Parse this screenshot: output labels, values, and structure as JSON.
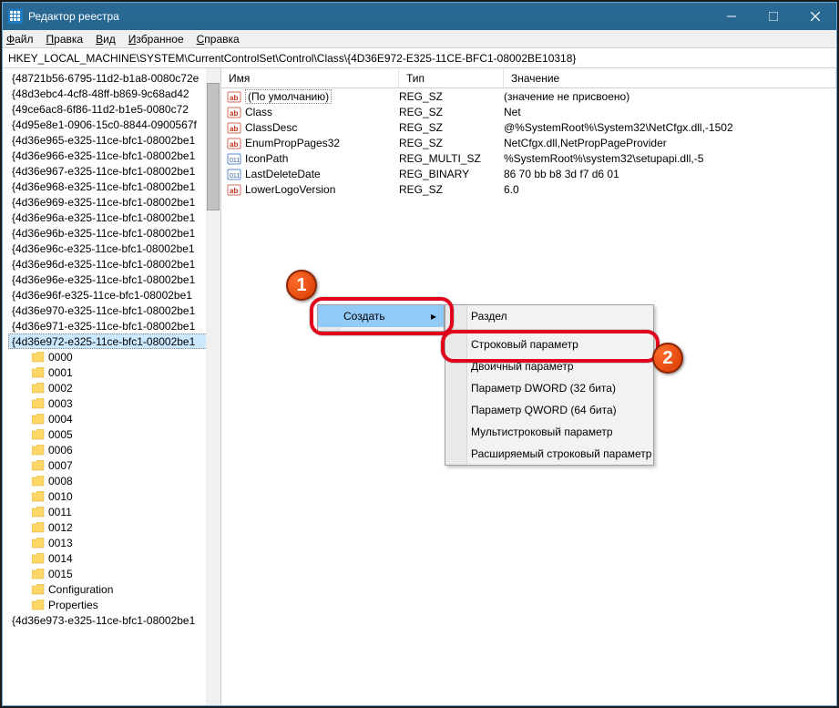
{
  "title": "Редактор реестра",
  "menus": [
    "Файл",
    "Правка",
    "Вид",
    "Избранное",
    "Справка"
  ],
  "address": "HKEY_LOCAL_MACHINE\\SYSTEM\\CurrentControlSet\\Control\\Class\\{4D36E972-E325-11CE-BFC1-08002BE10318}",
  "columns": {
    "name": "Имя",
    "type": "Тип",
    "value": "Значение"
  },
  "tree": [
    "{48721b56-6795-11d2-b1a8-0080c72e",
    "{48d3ebc4-4cf8-48ff-b869-9c68ad42",
    "{49ce6ac8-6f86-11d2-b1e5-0080c72",
    "{4d95e8e1-0906-15c0-8844-0900567f",
    "{4d36e965-e325-11ce-bfc1-08002be1",
    "{4d36e966-e325-11ce-bfc1-08002be1",
    "{4d36e967-e325-11ce-bfc1-08002be1",
    "{4d36e968-e325-11ce-bfc1-08002be1",
    "{4d36e969-e325-11ce-bfc1-08002be1",
    "{4d36e96a-e325-11ce-bfc1-08002be1",
    "{4d36e96b-e325-11ce-bfc1-08002be1",
    "{4d36e96c-e325-11ce-bfc1-08002be1",
    "{4d36e96d-e325-11ce-bfc1-08002be1",
    "{4d36e96e-e325-11ce-bfc1-08002be1",
    "{4d36e96f-e325-11ce-bfc1-08002be1",
    "{4d36e970-e325-11ce-bfc1-08002be1",
    "{4d36e971-e325-11ce-bfc1-08002be1"
  ],
  "tree_selected": "{4d36e972-e325-11ce-bfc1-08002be1",
  "subkeys": [
    "0000",
    "0001",
    "0002",
    "0003",
    "0004",
    "0005",
    "0006",
    "0007",
    "0008",
    "0010",
    "0011",
    "0012",
    "0013",
    "0014",
    "0015",
    "Configuration",
    "Properties"
  ],
  "tree_after": "{4d36e973-e325-11ce-bfc1-08002be1",
  "values": [
    {
      "name": "(По умолчанию)",
      "type": "REG_SZ",
      "value": "(значение не присвоено)",
      "icon": "ab",
      "default": true
    },
    {
      "name": "Class",
      "type": "REG_SZ",
      "value": "Net",
      "icon": "ab"
    },
    {
      "name": "ClassDesc",
      "type": "REG_SZ",
      "value": "@%SystemRoot%\\System32\\NetCfgx.dll,-1502",
      "icon": "ab"
    },
    {
      "name": "EnumPropPages32",
      "type": "REG_SZ",
      "value": "NetCfgx.dll,NetPropPageProvider",
      "icon": "ab"
    },
    {
      "name": "IconPath",
      "type": "REG_MULTI_SZ",
      "value": "%SystemRoot%\\system32\\setupapi.dll,-5",
      "icon": "bin"
    },
    {
      "name": "LastDeleteDate",
      "type": "REG_BINARY",
      "value": "86 70 bb b8 3d f7 d6 01",
      "icon": "bin"
    },
    {
      "name": "LowerLogoVersion",
      "type": "REG_SZ",
      "value": "6.0",
      "icon": "ab"
    }
  ],
  "context_menu": {
    "create": "Создать",
    "sub": [
      "Раздел",
      "Строковый параметр",
      "Двоичный параметр",
      "Параметр DWORD (32 бита)",
      "Параметр QWORD (64 бита)",
      "Мультистроковый параметр",
      "Расширяемый строковый параметр"
    ]
  },
  "badges": {
    "one": "1",
    "two": "2"
  }
}
